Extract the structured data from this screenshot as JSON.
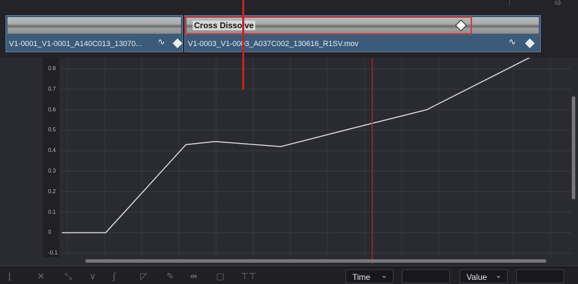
{
  "ruler": {
    "labels": [
      "",
      "60"
    ]
  },
  "clips": [
    {
      "name": "V1-0001_V1-0001_A140C013_13070...",
      "curve_icon": "curve-icon",
      "keyframe_icon": "keyframe-diamond-icon"
    },
    {
      "name": "V1-0003_V1-0003_A037C002_130616_R1SV.mov",
      "curve_icon": "curve-icon",
      "keyframe_icon": "keyframe-diamond-icon"
    }
  ],
  "transition": {
    "label": "Cross Dissolve",
    "keyframe_icon": "keyframe-diamond-icon",
    "border_color": "#d33c3c"
  },
  "y_axis": {
    "ticks": [
      "0.8",
      "0.7",
      "0.6",
      "0.5",
      "0.4",
      "0.3",
      "0.2",
      "0.1",
      "0",
      "-0.1"
    ]
  },
  "curve": {
    "color": "#e8e8e8",
    "points": [
      [
        0,
        0
      ],
      [
        0.12,
        0
      ],
      [
        0.34,
        0.43
      ],
      [
        0.42,
        0.445
      ],
      [
        0.6,
        0.42
      ],
      [
        0.82,
        0.52
      ],
      [
        1.0,
        0.6
      ],
      [
        1.3,
        0.87
      ]
    ]
  },
  "toolbar": {
    "tools": [
      "linear-icon",
      "bezier-icon",
      "ease-in-icon",
      "ease-out-icon",
      "ease-in-out-icon",
      "select-icon",
      "pen-icon",
      "stretch-icon",
      "fit-icon",
      "align-icon"
    ],
    "time_dropdown": "Time",
    "value_dropdown": "Value"
  },
  "colors": {
    "playhead": "#b0221f",
    "clip": "#3c5b79",
    "background": "#28282e"
  }
}
